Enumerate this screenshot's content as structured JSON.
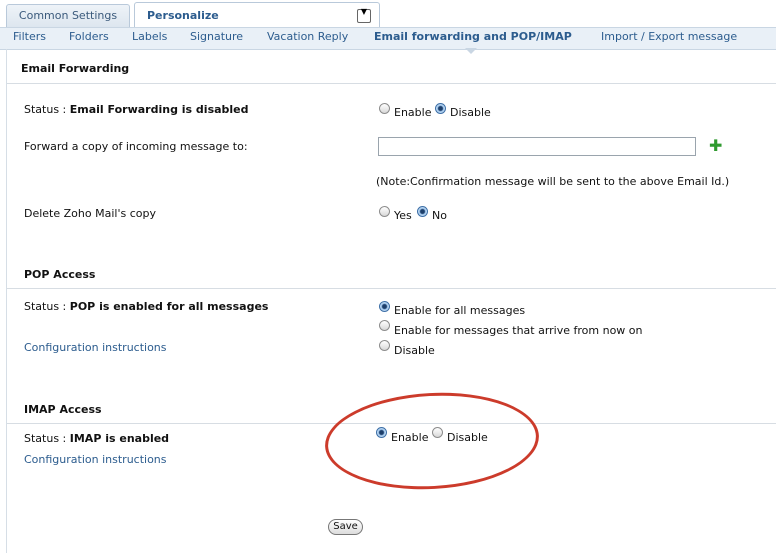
{
  "top_tabs": {
    "common": "Common Settings",
    "personalize": "Personalize"
  },
  "subnav": [
    "Filters",
    "Folders",
    "Labels",
    "Signature",
    "Vacation Reply",
    "Email forwarding and POP/IMAP",
    "Import / Export message"
  ],
  "subnav_active": "Email forwarding and POP/IMAP",
  "email_forwarding": {
    "title": "Email Forwarding",
    "status_prefix": "Status : ",
    "status_text": "Email Forwarding is disabled",
    "enable": "Enable",
    "disable": "Disable",
    "selected": "Disable",
    "forward_label": "Forward a copy of incoming message to:",
    "forward_value": "",
    "note": "(Note:Confirmation message will be sent to the above Email Id.)",
    "delete_label": "Delete Zoho Mail's copy",
    "yes": "Yes",
    "no": "No",
    "delete_selected": "No"
  },
  "pop": {
    "title": "POP Access",
    "status_prefix": "Status : ",
    "status_text": "POP is enabled for all messages",
    "config_link": "Configuration instructions",
    "options": [
      "Enable for all messages",
      "Enable for messages that arrive from now on",
      "Disable"
    ],
    "selected": "Enable for all messages"
  },
  "imap": {
    "title": "IMAP Access",
    "status_prefix": "Status : ",
    "status_text": "IMAP is enabled",
    "config_link": "Configuration instructions",
    "enable": "Enable",
    "disable": "Disable",
    "selected": "Enable"
  },
  "save_label": "Save",
  "colors": {
    "link": "#2c5c8e",
    "annotation": "#cc3b2b",
    "subnav_bg": "#e9f0f7"
  },
  "icons": {
    "add_email": "plus-icon",
    "tab_menu": "chevron-down-icon"
  }
}
